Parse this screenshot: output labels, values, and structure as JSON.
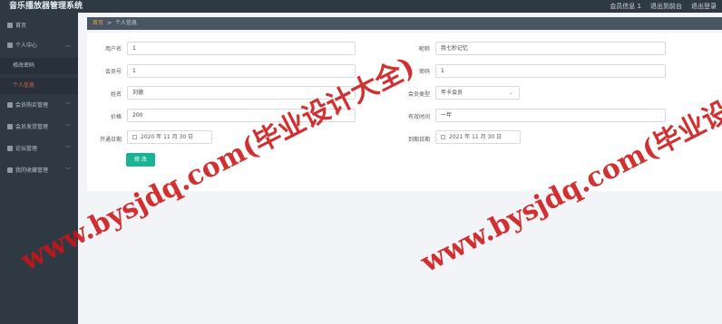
{
  "app": {
    "title": "音乐播放器管理系统",
    "nav": [
      "会员信息 1",
      "退出到前台",
      "退出登录"
    ]
  },
  "sidebar": {
    "home": "首页",
    "personal_center": "个人中心",
    "personal_children": [
      "修改密码",
      "个人信息"
    ],
    "items": [
      "会员购买管理",
      "会员发货管理",
      "论坛管理",
      "我的收藏管理"
    ]
  },
  "breadcrumb": {
    "home": "首页",
    "separator": ">",
    "current": "个人信息"
  },
  "form": {
    "username_label": "用户名",
    "username": "1",
    "nickname_label": "昵称",
    "nickname": "我七秒记忆",
    "member_no_label": "会员号",
    "member_no": "1",
    "password_label": "密码",
    "password": "1",
    "name_label": "姓名",
    "name": "刘德",
    "member_type_label": "会员类型",
    "member_type": "年卡会员",
    "price_label": "价格",
    "price": "200",
    "valid_period_label": "有效时间",
    "valid_period": "一年",
    "start_date_label": "开通日期",
    "start_date": "2020 年 11 月 30 日",
    "end_date_label": "到期日期",
    "end_date": "2021 年 11 月 30 日",
    "submit": "修 改"
  },
  "watermark": "www.bysjdq.com(毕业设计大全)",
  "colors": {
    "sidebar_bg": "#2f3944",
    "accent": "#1ab394",
    "active": "#e0603c",
    "watermark": "#cc1414"
  }
}
